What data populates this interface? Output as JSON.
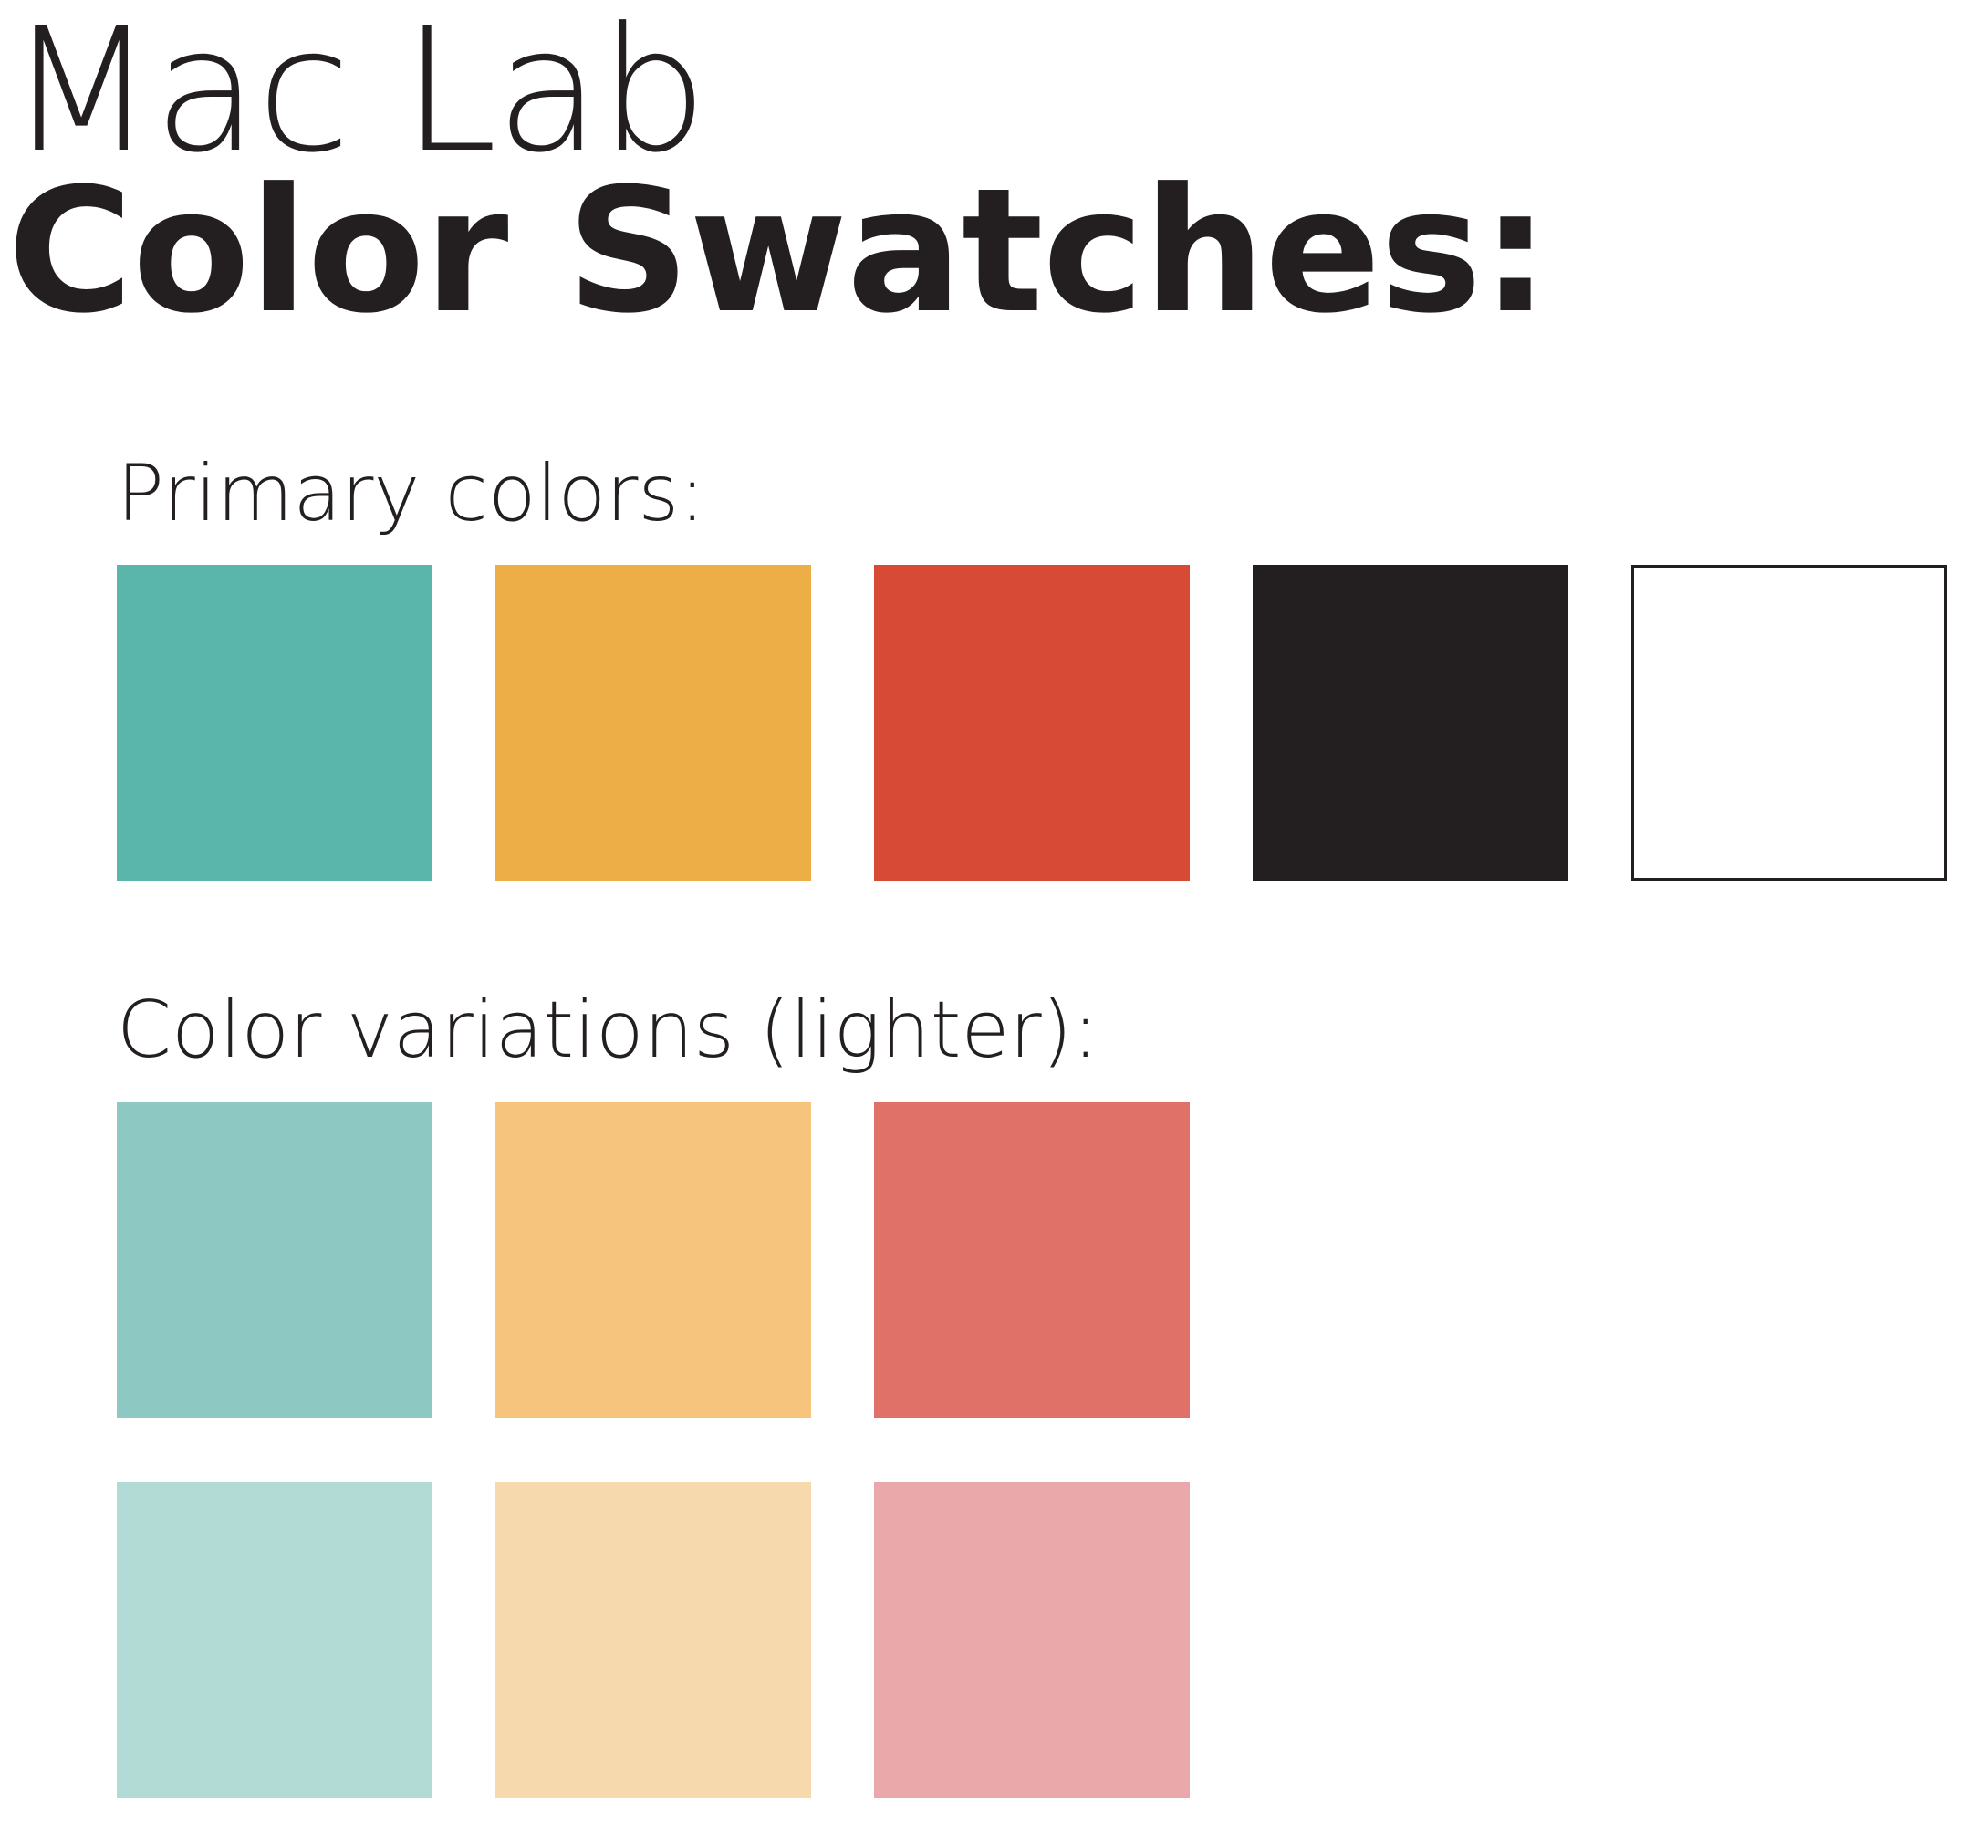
{
  "header": {
    "title_line1": "Mac Lab",
    "title_line2": "Color Swatches:"
  },
  "primary": {
    "label": "Primary colors:",
    "swatches": [
      {
        "name": "teal",
        "color": "#5ab5aa"
      },
      {
        "name": "orange",
        "color": "#edae47"
      },
      {
        "name": "red",
        "color": "#d64a36"
      },
      {
        "name": "black",
        "color": "#231f20"
      },
      {
        "name": "white",
        "color": "#ffffff"
      }
    ]
  },
  "variations": {
    "label": "Color variations (lighter):",
    "rows": [
      [
        {
          "name": "teal-light",
          "color": "#8dc8c2"
        },
        {
          "name": "orange-light",
          "color": "#f6c47c"
        },
        {
          "name": "red-light",
          "color": "#e07168"
        }
      ],
      [
        {
          "name": "teal-lighter",
          "color": "#b2dbd6"
        },
        {
          "name": "orange-lighter",
          "color": "#f7d9ae"
        },
        {
          "name": "red-lighter",
          "color": "#eaa8aa"
        }
      ]
    ]
  }
}
